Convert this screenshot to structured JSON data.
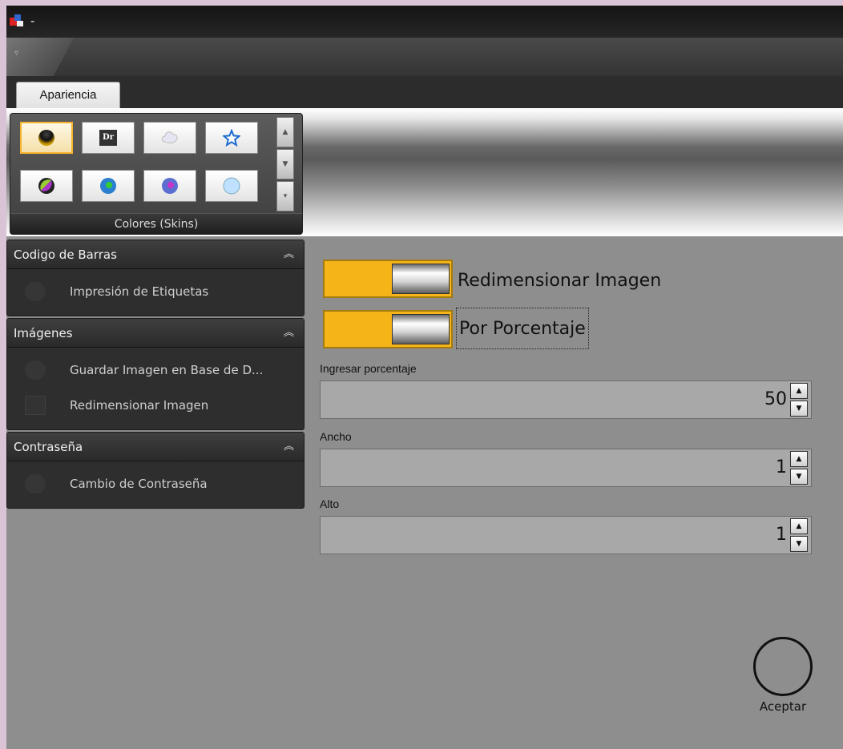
{
  "window": {
    "title": "-"
  },
  "tabs": [
    {
      "label": "Apariencia"
    }
  ],
  "ribbon": {
    "skins_group_label": "Colores (Skins)",
    "skins": [
      {
        "name": "dark-sphere"
      },
      {
        "name": "dr-logo",
        "text": "Dr"
      },
      {
        "name": "cloud"
      },
      {
        "name": "star"
      },
      {
        "name": "purple-green-sphere"
      },
      {
        "name": "blue-green-sphere"
      },
      {
        "name": "purple-sphere"
      },
      {
        "name": "light-blue-sphere"
      }
    ]
  },
  "nav": {
    "groups": [
      {
        "title": "Codigo de Barras",
        "items": [
          {
            "label": "Impresión de Etiquetas"
          }
        ]
      },
      {
        "title": "Imágenes",
        "items": [
          {
            "label": "Guardar Imagen en Base de D..."
          },
          {
            "label": "Redimensionar Imagen"
          }
        ]
      },
      {
        "title": "Contraseña",
        "items": [
          {
            "label": "Cambio de Contraseña"
          }
        ]
      }
    ]
  },
  "content": {
    "toggle_resize": {
      "label": "Redimensionar Imagen"
    },
    "toggle_percent": {
      "label": "Por Porcentaje"
    },
    "percent": {
      "label": "Ingresar porcentaje",
      "value": "50"
    },
    "width": {
      "label": "Ancho",
      "value": "1"
    },
    "height": {
      "label": "Alto",
      "value": "1"
    },
    "accept_label": "Aceptar"
  },
  "colors": {
    "accent": "#f5b417",
    "background": "#8e8e8e"
  }
}
